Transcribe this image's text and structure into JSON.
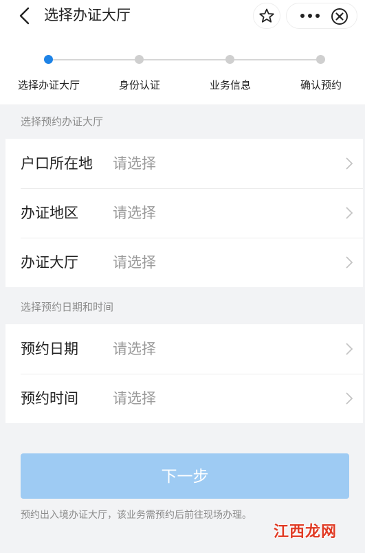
{
  "header": {
    "title": "选择办证大厅",
    "back_icon": "chevron-left-icon",
    "favorite_icon": "star-outline-icon",
    "more_icon": "ellipsis-icon",
    "close_icon": "close-circle-icon"
  },
  "steps": {
    "current": 0,
    "items": [
      {
        "label": "选择办证大厅"
      },
      {
        "label": "身份认证"
      },
      {
        "label": "业务信息"
      },
      {
        "label": "确认预约"
      }
    ],
    "active_color": "#1e83e6",
    "inactive_color": "#cfcfcf"
  },
  "hall_section": {
    "heading": "选择预约办证大厅",
    "rows": [
      {
        "label": "户口所在地",
        "value": "请选择"
      },
      {
        "label": "办证地区",
        "value": "请选择"
      },
      {
        "label": "办证大厅",
        "value": "请选择"
      }
    ]
  },
  "time_section": {
    "heading": "选择预约日期和时间",
    "rows": [
      {
        "label": "预约日期",
        "value": "请选择"
      },
      {
        "label": "预约时间",
        "value": "请选择"
      }
    ]
  },
  "footer": {
    "next_label": "下一步",
    "next_enabled": false,
    "note": "预约出入境办证大厅，该业务需预约后前往现场办理。"
  },
  "watermark": {
    "text": "江西龙网"
  },
  "colors": {
    "accent": "#1e83e6",
    "button_disabled": "#9ecbf3",
    "page_bg": "#f2f3f5"
  }
}
